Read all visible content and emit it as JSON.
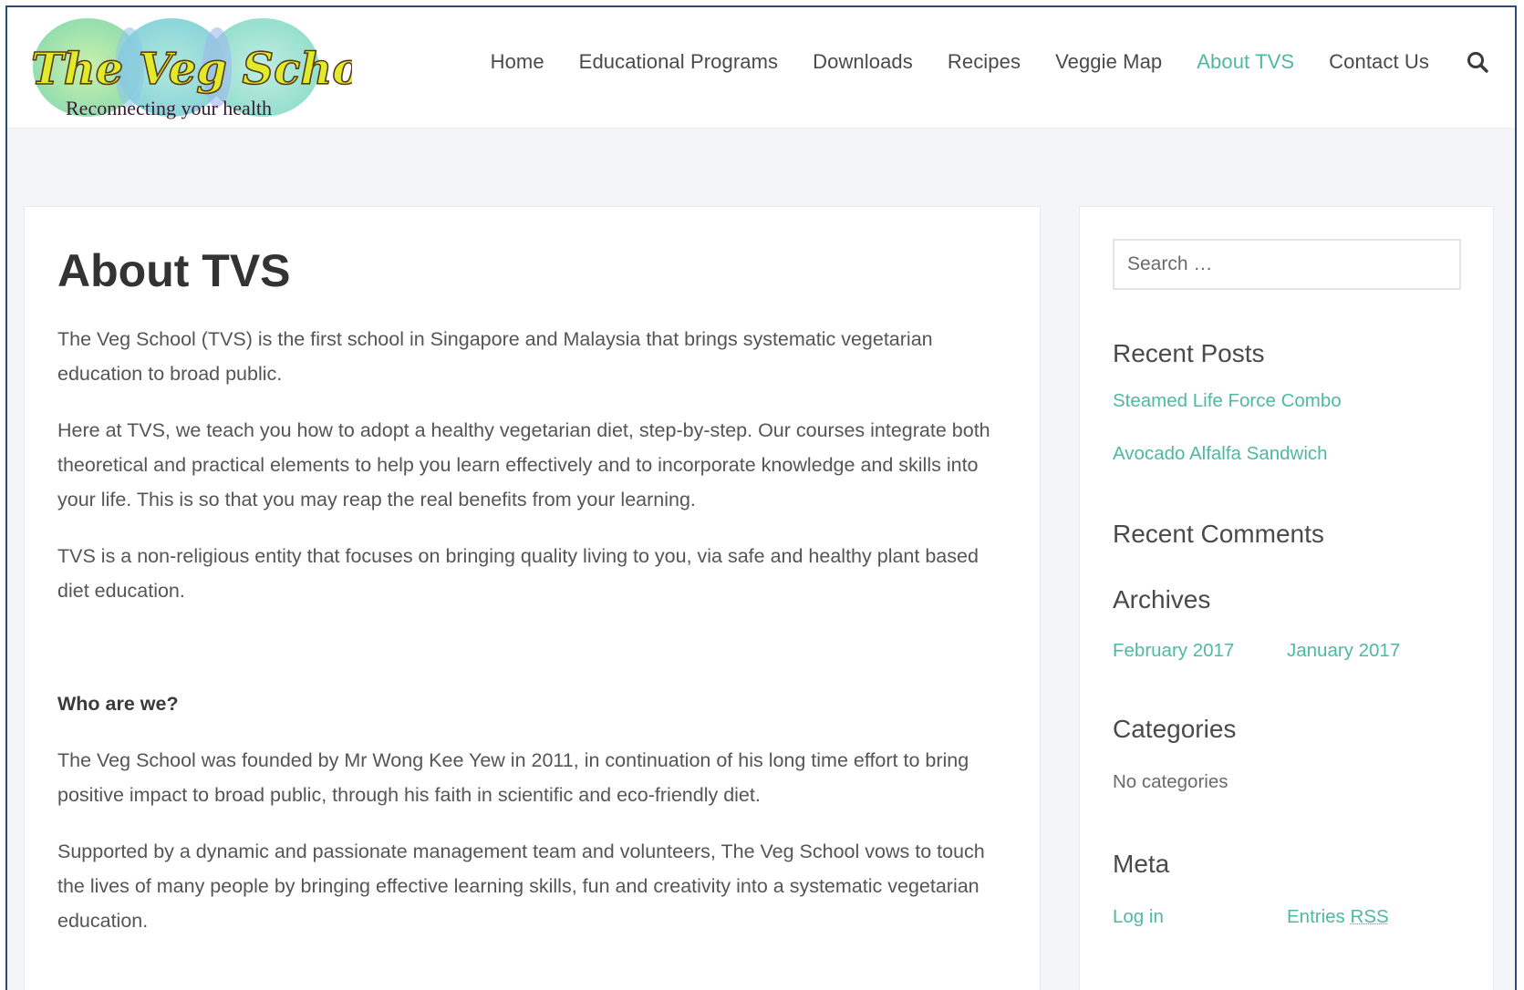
{
  "header": {
    "logo_title": "The Veg School",
    "logo_tagline": "Reconnecting your health",
    "nav": [
      {
        "label": "Home",
        "active": false
      },
      {
        "label": "Educational Programs",
        "active": false
      },
      {
        "label": "Downloads",
        "active": false
      },
      {
        "label": "Recipes",
        "active": false
      },
      {
        "label": "Veggie Map",
        "active": false
      },
      {
        "label": "About TVS",
        "active": true
      },
      {
        "label": "Contact Us",
        "active": false
      }
    ],
    "search_icon": "search-icon"
  },
  "article": {
    "title": "About TVS",
    "paragraphs": [
      "The Veg School (TVS) is the first school in Singapore and Malaysia that brings systematic vegetarian education to broad public.",
      "Here at TVS, we teach you how to adopt a healthy vegetarian diet, step-by-step. Our courses integrate both theoretical and practical elements to help you learn effectively and to incorporate knowledge and skills into your life. This is so that you may reap the real benefits from your learning.",
      "TVS is a non-religious entity that focuses on bringing quality living to you, via safe and healthy plant based diet education."
    ],
    "subheading": "Who are we?",
    "paragraphs2": [
      "The Veg School was founded by Mr Wong Kee Yew in 2011, in continuation of his long time effort to bring positive impact to broad public, through his faith in scientific and eco-friendly diet.",
      "Supported by a dynamic and passionate management team and volunteers, The Veg School vows to touch the lives of many people by bringing effective learning skills, fun and creativity into a systematic vegetarian education."
    ]
  },
  "sidebar": {
    "search_placeholder": "Search …",
    "recent_posts": {
      "title": "Recent Posts",
      "items": [
        "Steamed Life Force Combo",
        "Avocado Alfalfa Sandwich"
      ]
    },
    "recent_comments": {
      "title": "Recent Comments"
    },
    "archives": {
      "title": "Archives",
      "items": [
        "February 2017",
        "January 2017"
      ]
    },
    "categories": {
      "title": "Categories",
      "empty_text": "No categories"
    },
    "meta": {
      "title": "Meta",
      "login": "Log in",
      "entries_prefix": "Entries",
      "entries_rss": "RSS"
    }
  },
  "colors": {
    "accent": "#4fb99f",
    "text": "#555555",
    "heading": "#333333",
    "background": "#f4f5f7",
    "frame_border": "#2e4a7a"
  }
}
